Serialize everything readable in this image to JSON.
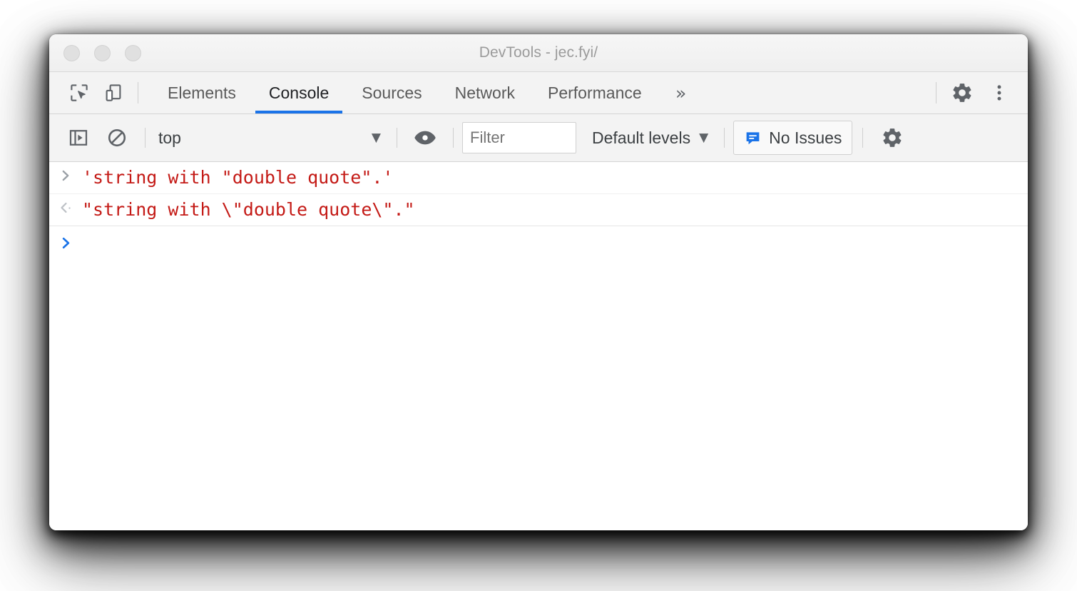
{
  "window": {
    "title": "DevTools - jec.fyi/",
    "traffic_lights": [
      "close",
      "minimize",
      "maximize"
    ]
  },
  "tabbar": {
    "inspect_icon": "inspect-element-icon",
    "device_icon": "device-toolbar-icon",
    "tabs": [
      {
        "label": "Elements",
        "active": false
      },
      {
        "label": "Console",
        "active": true
      },
      {
        "label": "Sources",
        "active": false
      },
      {
        "label": "Network",
        "active": false
      },
      {
        "label": "Performance",
        "active": false
      }
    ],
    "more_tabs_label": "»",
    "settings_icon": "gear-icon",
    "menu_icon": "three-dot-menu-icon"
  },
  "console_toolbar": {
    "sidebar_toggle_icon": "console-sidebar-icon",
    "clear_icon": "clear-console-icon",
    "context": {
      "label": "top",
      "caret": "▼"
    },
    "eye_icon": "live-expression-eye-icon",
    "filter": {
      "value": "",
      "placeholder": "Filter"
    },
    "levels": {
      "label": "Default levels",
      "caret": "▼"
    },
    "issues": {
      "label": "No Issues",
      "icon": "issues-bubble-icon"
    },
    "settings_icon": "console-settings-gear-icon"
  },
  "console": {
    "messages": [
      {
        "kind": "input",
        "gutter": "❯",
        "text": "'string with \"double quote\".'"
      },
      {
        "kind": "output",
        "gutter": "❮",
        "text": "\"string with \\\"double quote\\\".\""
      }
    ],
    "prompt": {
      "gutter": "❯",
      "value": ""
    }
  },
  "colors": {
    "accent_blue": "#1a73e8",
    "string_red": "#c41a16",
    "toolbar_bg": "#f3f3f3",
    "title_text": "#9b9b9b",
    "icon_gray": "#5f6368"
  }
}
